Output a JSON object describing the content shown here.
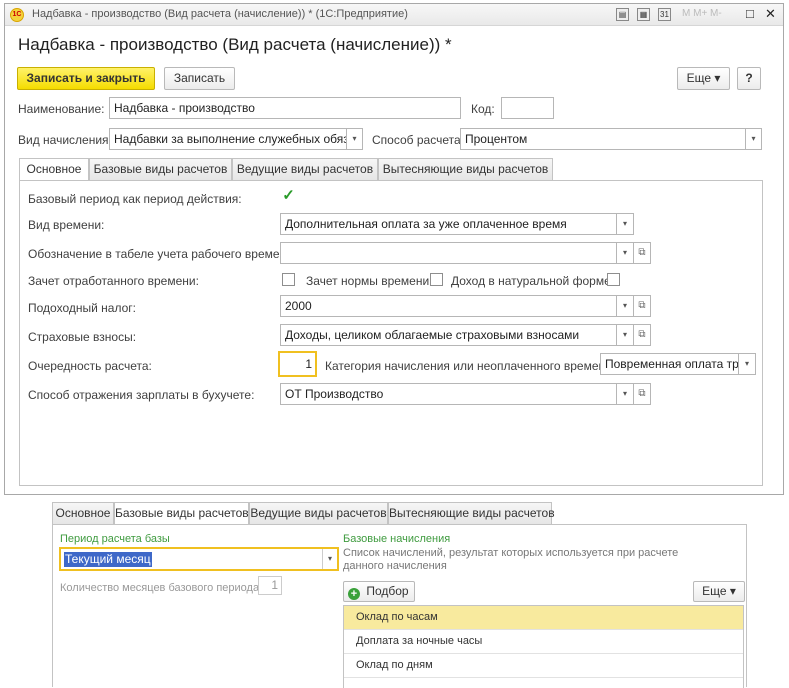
{
  "window": {
    "title": "Надбавка - производство (Вид расчета (начисление)) * (1С:Предприятие)",
    "logo_text": "1С",
    "tb_icons": [
      "▤",
      "▦",
      "31"
    ],
    "grey_buttons": "M  M+  M-",
    "controls": {
      "restore": "□",
      "close": "✕"
    }
  },
  "form": {
    "title": "Надбавка - производство (Вид расчета (начисление)) *",
    "toolbar": {
      "save_close": "Записать и закрыть",
      "save": "Записать",
      "more": "Еще ▾",
      "help": "?"
    },
    "name_label": "Наименование:",
    "name_value": "Надбавка - производство",
    "code_label": "Код:",
    "code_value": "",
    "vid_label": "Вид начисления:",
    "vid_value": "Надбавки за выполнение служебных обязан",
    "sposob_label": "Способ расчета:",
    "sposob_value": "Процентом",
    "tabs": [
      "Основное",
      "Базовые виды расчетов",
      "Ведущие виды расчетов",
      "Вытесняющие виды расчетов"
    ],
    "main": {
      "base_period_label": "Базовый период как период действия:",
      "base_period_check": "✓",
      "vid_time_label": "Вид времени:",
      "vid_time_value": "Дополнительная оплата за уже оплаченное время",
      "oboznach_label": "Обозначение в табеле учета рабочего времени:",
      "oboznach_value": "",
      "zachet_label": "Зачет отработанного времени:",
      "zachet_norm_label": "Зачет нормы времени:",
      "dohod_nat_label": "Доход в натуральной форме:",
      "ndfl_label": "Подоходный налог:",
      "ndfl_value": "2000",
      "strah_label": "Страховые взносы:",
      "strah_value": "Доходы, целиком облагаемые страховыми взносами",
      "order_label": "Очередность расчета:",
      "order_value": "1",
      "category_label": "Категория начисления или неоплаченного времени:",
      "category_value": "Повременная оплата труд",
      "otrazh_label": "Способ отражения зарплаты в бухучете:",
      "otrazh_value": "ОТ Производство"
    }
  },
  "lower": {
    "tabs": [
      "Основное",
      "Базовые виды расчетов",
      "Ведущие виды расчетов",
      "Вытесняющие виды расчетов"
    ],
    "period_label": "Период расчета базы",
    "period_value": "Текущий месяц",
    "months_label": "Количество месяцев базового периода:",
    "months_value": "1",
    "base_label": "Базовые начисления",
    "base_hint1": "Список начислений, результат которых используется при расчете",
    "base_hint2": "данного начисления",
    "podbor": "Подбор",
    "more": "Еще ▾",
    "rows": [
      "Оклад по часам",
      "Доплата за ночные часы",
      "Оклад по дням"
    ]
  },
  "colors": {
    "accent_yellow": "#f5dc00",
    "selection": "#f8ea9e",
    "green_label": "#3f9b3f",
    "focus_border": "#f0c020"
  },
  "icons": {
    "dropdown": "▾",
    "open": "⧉",
    "check": "✓",
    "add": "+"
  }
}
